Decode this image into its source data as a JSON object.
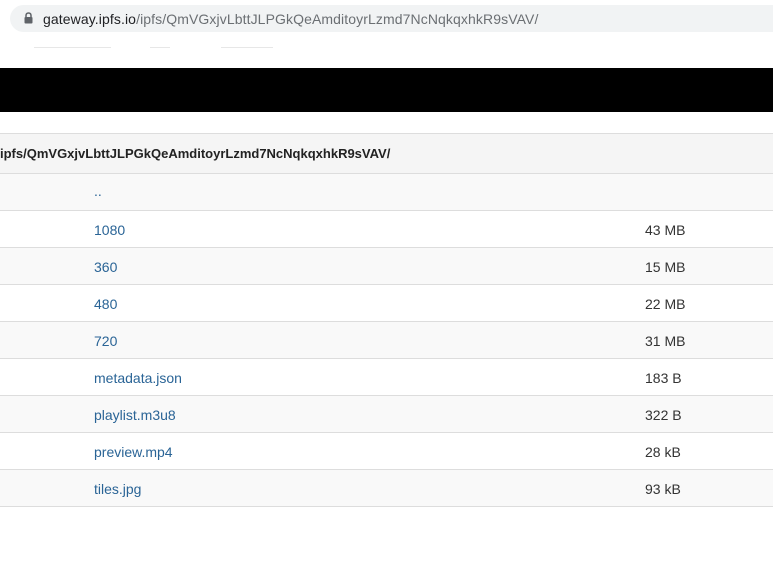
{
  "browser": {
    "url_domain": "gateway.ipfs.io",
    "url_path": "/ipfs/QmVGxjvLbttJLPGkQeAmditoyrLzmd7NcNqkqxhkR9sVAV/"
  },
  "listing": {
    "path_header": "ipfs/QmVGxjvLbttJLPGkQeAmditoyrLzmd7NcNqkqxhkR9sVAV/",
    "parent_link": "..",
    "items": [
      {
        "name": "1080",
        "size": "43 MB"
      },
      {
        "name": "360",
        "size": "15 MB"
      },
      {
        "name": "480",
        "size": "22 MB"
      },
      {
        "name": "720",
        "size": "31 MB"
      },
      {
        "name": "metadata.json",
        "size": "183 B"
      },
      {
        "name": "playlist.m3u8",
        "size": "322 B"
      },
      {
        "name": "preview.mp4",
        "size": "28 kB"
      },
      {
        "name": "tiles.jpg",
        "size": "93 kB"
      }
    ]
  }
}
